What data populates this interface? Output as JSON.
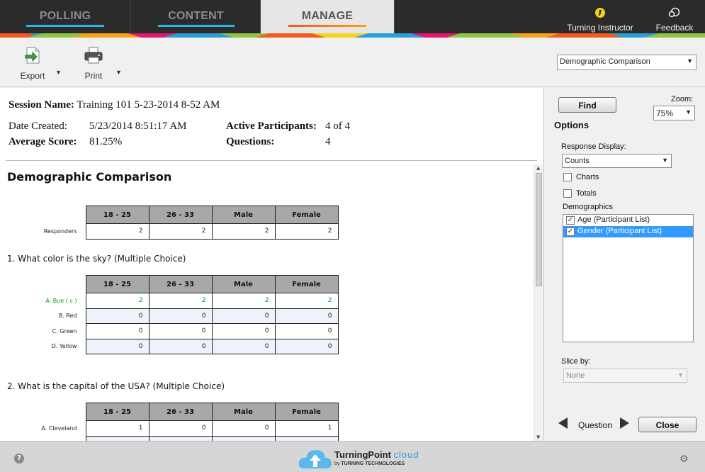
{
  "nav": {
    "tabs": [
      {
        "label": "POLLING",
        "underline": "#29b6e8"
      },
      {
        "label": "CONTENT",
        "underline": "#29b6e8"
      },
      {
        "label": "MANAGE",
        "underline": "#f25a1f",
        "active": true
      }
    ],
    "instructor_label": "Turning Instructor",
    "feedback_label": "Feedback"
  },
  "toolbar": {
    "export_label": "Export",
    "print_label": "Print",
    "view_select": "Demographic Comparison"
  },
  "session": {
    "name_label": "Session Name:",
    "name_value": "Training 101 5-23-2014 8-52 AM",
    "date_label": "Date Created:",
    "date_value": "5/23/2014 8:51:17 AM",
    "avg_label": "Average Score:",
    "avg_value": "81.25%",
    "active_label": "Active Participants:",
    "active_value": "4 of 4",
    "questions_label": "Questions:",
    "questions_value": "4"
  },
  "report": {
    "title": "Demographic Comparison",
    "columns": [
      "18 - 25",
      "26 - 33",
      "Male",
      "Female"
    ],
    "responders": {
      "label": "Responders",
      "values": [
        "2",
        "2",
        "2",
        "2"
      ]
    },
    "q1": {
      "title": "1. What color is the sky? (Multiple Choice)",
      "rows": [
        {
          "label": "A. Bue ( c )",
          "values": [
            "2",
            "2",
            "2",
            "2"
          ],
          "correct": true
        },
        {
          "label": "B. Red",
          "values": [
            "0",
            "0",
            "0",
            "0"
          ]
        },
        {
          "label": "C. Green",
          "values": [
            "0",
            "0",
            "0",
            "0"
          ]
        },
        {
          "label": "D. Yellow",
          "values": [
            "0",
            "0",
            "0",
            "0"
          ]
        }
      ]
    },
    "q2": {
      "title": "2. What is the capital of the USA? (Multiple Choice)",
      "rows": [
        {
          "label": "A. Cleveland",
          "values": [
            "1",
            "0",
            "0",
            "1"
          ]
        }
      ]
    }
  },
  "options": {
    "find_label": "Find",
    "zoom_label": "Zoom:",
    "zoom_value": "75%",
    "title": "Options",
    "response_display_label": "Response Display:",
    "response_display_value": "Counts",
    "charts_label": "Charts",
    "totals_label": "Totals",
    "demographics_label": "Demographics",
    "demographics": [
      {
        "label": "Age (Participant List)",
        "checked": true
      },
      {
        "label": "Gender (Participant List)",
        "checked": true,
        "selected": true
      }
    ],
    "slice_label": "Slice by:",
    "slice_value": "None",
    "question_label": "Question",
    "close_label": "Close"
  },
  "footer": {
    "brand_main": "TurningPoint",
    "brand_sub": "cloud",
    "brand_by": "by",
    "brand_company": "TURNING TECHNOLOGIES",
    "help_glyph": "?"
  },
  "colors": {
    "nav_bg": "#2b2b2b",
    "accent_blue": "#29b6e8",
    "accent_orange": "#f25a1f",
    "correct_green": "#119911",
    "selection_blue": "#3399ff"
  }
}
